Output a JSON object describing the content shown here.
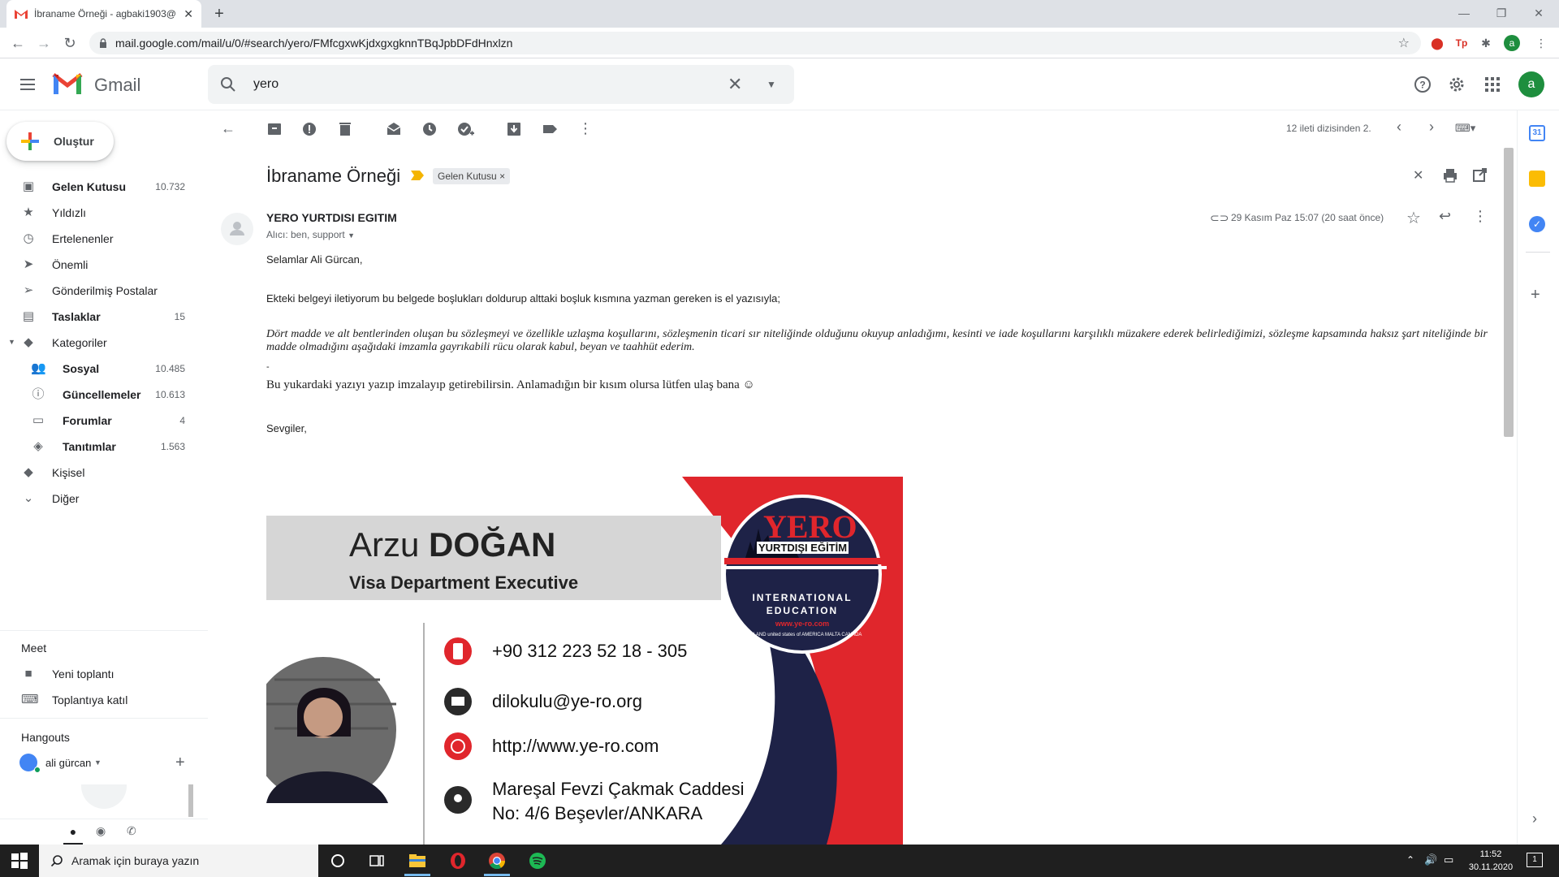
{
  "browser": {
    "tab_title": "İbraname Örneği - agbaki1903@",
    "tab_close": "✕",
    "new_tab": "+",
    "url": "mail.google.com/mail/u/0/#search/yero/FMfcgxwKjdxgxgknnTBqJpbDFdHnxlzn"
  },
  "gmail": {
    "app_name": "Gmail",
    "search_value": "yero",
    "avatar_letter": "a"
  },
  "nav": {
    "compose": "Oluştur",
    "items": [
      {
        "label": "Gelen Kutusu",
        "count": "10.732",
        "icon": "inbox-icon"
      },
      {
        "label": "Yıldızlı",
        "count": "",
        "icon": "star-icon"
      },
      {
        "label": "Ertelenenler",
        "count": "",
        "icon": "clock-icon"
      },
      {
        "label": "Önemli",
        "count": "",
        "icon": "important-icon"
      },
      {
        "label": "Gönderilmiş Postalar",
        "count": "",
        "icon": "send-icon"
      },
      {
        "label": "Taslaklar",
        "count": "15",
        "icon": "draft-icon"
      },
      {
        "label": "Kategoriler",
        "count": "",
        "icon": "label-icon"
      }
    ],
    "categories": [
      {
        "label": "Sosyal",
        "count": "10.485",
        "icon": "people-icon"
      },
      {
        "label": "Güncellemeler",
        "count": "10.613",
        "icon": "info-icon"
      },
      {
        "label": "Forumlar",
        "count": "4",
        "icon": "forum-icon"
      },
      {
        "label": "Tanıtımlar",
        "count": "1.563",
        "icon": "tag-icon"
      }
    ],
    "kisisel": "Kişisel",
    "diger": "Diğer"
  },
  "meet": {
    "title": "Meet",
    "new_meeting": "Yeni toplantı",
    "join_meeting": "Toplantıya katıl"
  },
  "hangouts": {
    "title": "Hangouts",
    "user": "ali gürcan"
  },
  "email": {
    "pager": "12 ileti dizisinden 2.",
    "subject": "İbraname Örneği",
    "label": "Gelen Kutusu",
    "label_x": "×",
    "sender": "YERO YURTDISI EGITIM",
    "recipients": "Alıcı: ben, support",
    "date": "29 Kasım Paz 15:07 (20 saat önce)",
    "greeting": "Selamlar Ali Gürcan,",
    "line1": "Ekteki belgeyi iletiyorum bu belgede boşlukları doldurup alttaki boşluk kısmına yazman gereken is el yazısıyla;",
    "italic": "Dört madde ve alt bentlerinden oluşan bu sözleşmeyi ve özellikle uzlaşma koşullarını, sözleşmenin ticari sır niteliğinde olduğunu okuyup anladığımı, kesinti ve iade koşullarını karşılıklı müzakere ederek belirlediğimizi, sözleşme kapsamında haksız şart niteliğinde bir madde olmadığını aşağıdaki imzamla gayrıkabili rücu olarak kabul, beyan ve taahhüt ederim.",
    "dash": "-",
    "line2": "Bu yukardaki yazıyı yazıp imzalayıp getirebilirsin. Anlamadığın bir kısım olursa lütfen ulaş bana ☺",
    "signoff": "Sevgiler,"
  },
  "card": {
    "first_name": "Arzu",
    "last_name": "DOĞAN",
    "role": "Visa Department Executive",
    "phone": "+90 312 223 52 18 - 305",
    "email": "dilokulu@ye-ro.org",
    "web": "http://www.ye-ro.com",
    "address1": "Mareşal Fevzi Çakmak Caddesi",
    "address2": "No: 4/6   Beşevler/ANKARA",
    "logo_big": "YERO",
    "logo_sub": "YURTDIŞI EĞİTİM",
    "logo_intl1": "INTERNATIONAL",
    "logo_intl2": "EDUCATION",
    "logo_url": "www.ye-ro.com",
    "logo_ring": "ENGLAND  united states of AMERICA  MALTA  CANADA"
  },
  "taskbar": {
    "search_placeholder": "Aramak için buraya yazın",
    "time": "11:52",
    "date": "30.11.2020",
    "notif_count": "1"
  },
  "colors": {
    "red": "#e0262c",
    "navy": "#1e2247",
    "gmail_red": "#ea4335",
    "green": "#1e8e3e"
  }
}
